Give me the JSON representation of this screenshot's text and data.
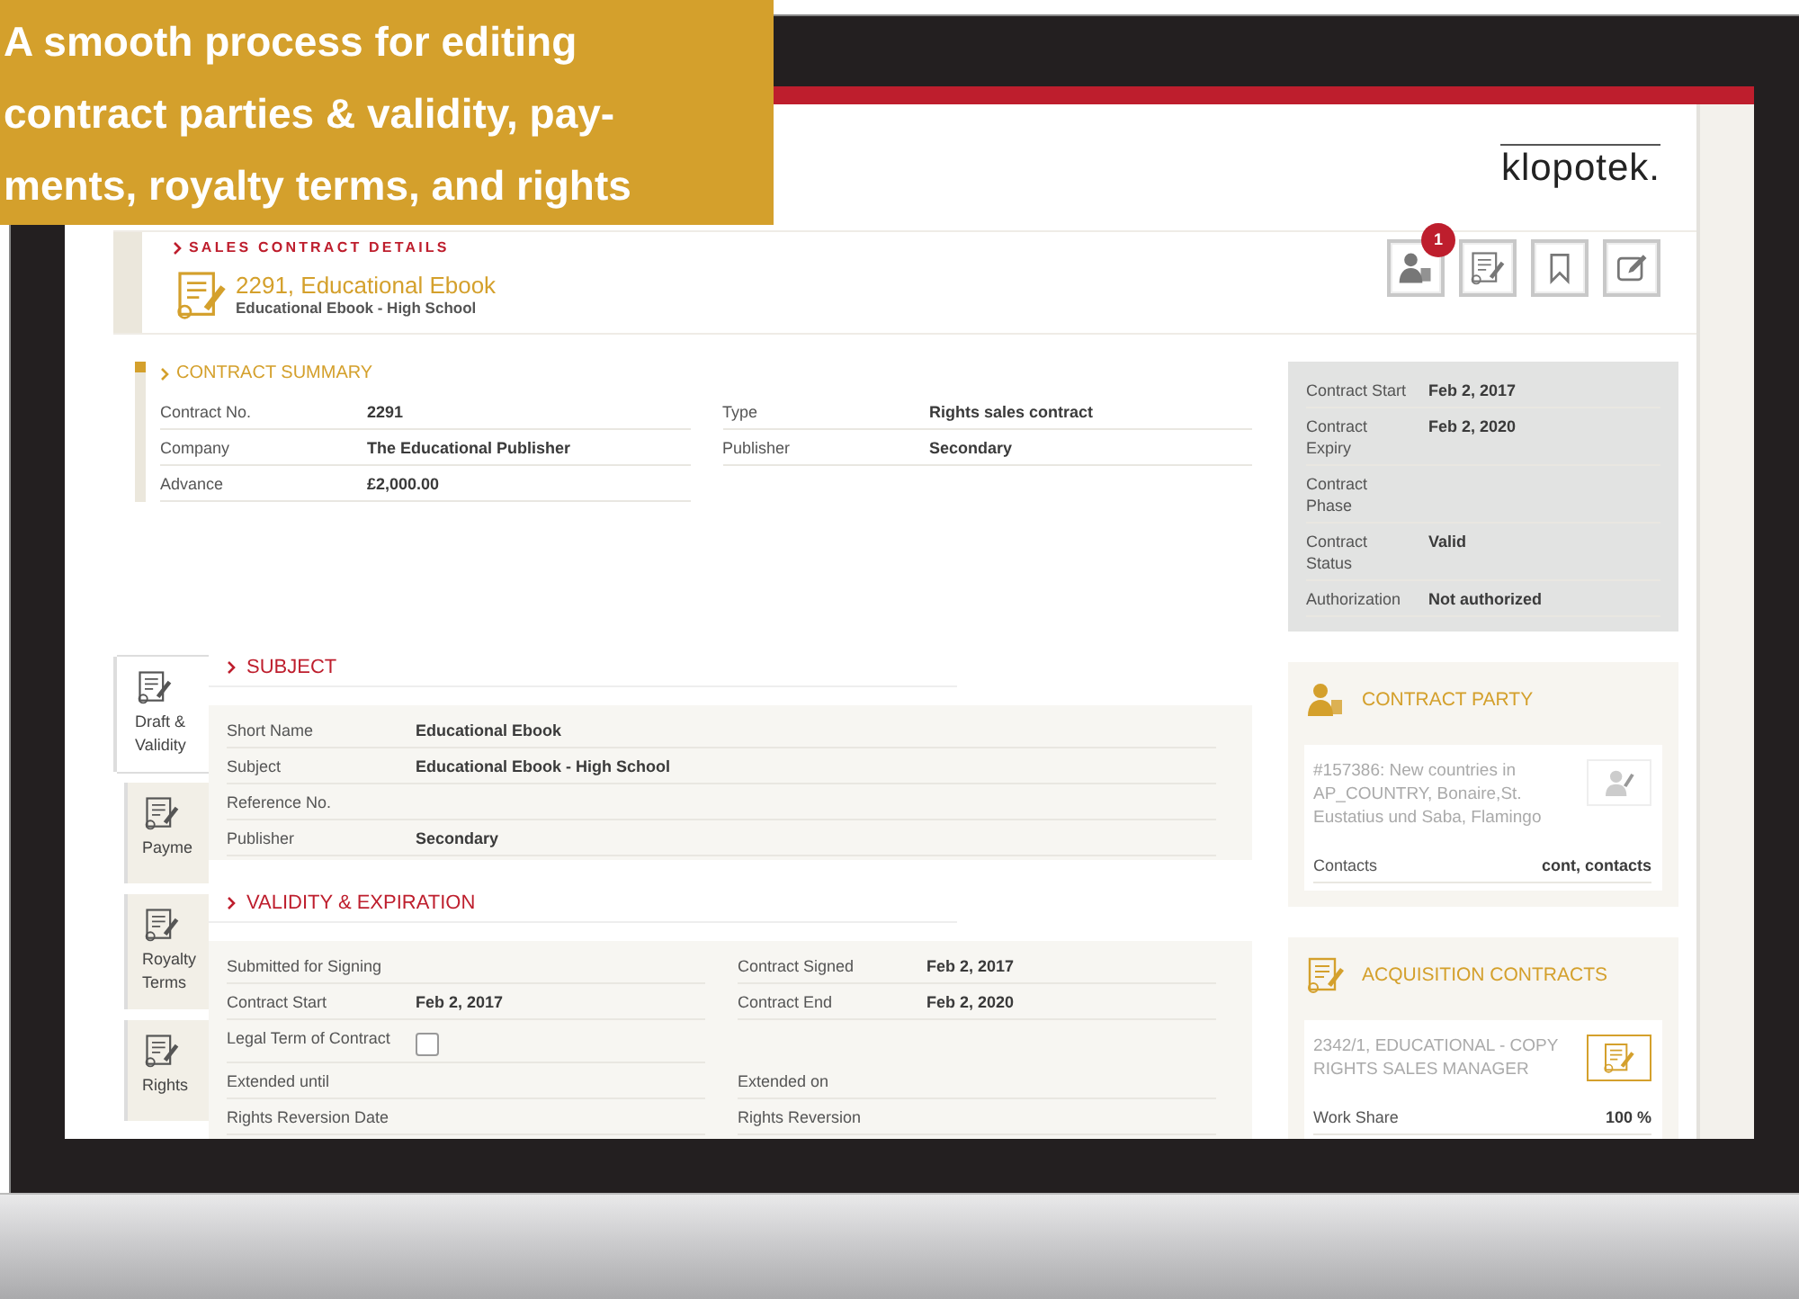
{
  "banner": {
    "lines": [
      "A smooth process for editing",
      "contract parties & validity, pay-",
      "ments, royalty terms, and rights"
    ]
  },
  "header": {
    "logo": "klopotek.",
    "breadcrumb": "SALES CONTRACT DETAILS",
    "title": "2291, Educational Ebook",
    "subtitle": "Educational Ebook - High School",
    "toolbar": [
      {
        "kind": "people",
        "badge": "1"
      },
      {
        "kind": "contract"
      },
      {
        "kind": "bookmark"
      },
      {
        "kind": "edit"
      }
    ]
  },
  "summary": {
    "heading": "CONTRACT SUMMARY",
    "columns": [
      [
        {
          "label": "Contract No.",
          "value": "2291"
        },
        {
          "label": "Company",
          "value": "The Educational Publisher"
        },
        {
          "label": "Advance",
          "value": "£2,000.00"
        }
      ],
      [
        {
          "label": "Type",
          "value": "Rights sales contract"
        },
        {
          "label": "Publisher",
          "value": "Secondary"
        }
      ]
    ]
  },
  "status": {
    "fields": [
      {
        "label": "Contract Start",
        "value": "Feb 2, 2017"
      },
      {
        "label": "Contract Expiry",
        "value": "Feb 2, 2020"
      },
      {
        "label": "Contract Phase"
      },
      {
        "label": "Contract Status",
        "value": "Valid"
      },
      {
        "label": "Authorization",
        "value": "Not authorized"
      }
    ]
  },
  "tabs": [
    {
      "label": "Draft & Validity",
      "selected": true
    },
    {
      "label": "Payme",
      "selected": false
    },
    {
      "label": "Royalty Terms",
      "selected": false
    },
    {
      "label": "Rights",
      "selected": false
    }
  ],
  "subject": {
    "heading": "SUBJECT",
    "fields": [
      {
        "label": "Short Name",
        "value": "Educational Ebook"
      },
      {
        "label": "Subject",
        "value": "Educational Ebook - High School"
      },
      {
        "label": "Reference No."
      },
      {
        "label": "Publisher",
        "value": "Secondary"
      }
    ]
  },
  "validity": {
    "heading": "VALIDITY & EXPIRATION",
    "rows": [
      [
        {
          "kind": "text",
          "label": "Submitted for Signing"
        },
        {
          "kind": "text",
          "label": "Contract Signed",
          "value": "Feb 2, 2017"
        }
      ],
      [
        {
          "kind": "text",
          "label": "Contract Start",
          "value": "Feb 2, 2017"
        },
        {
          "kind": "text",
          "label": "Contract End",
          "value": "Feb 2, 2020"
        }
      ],
      [
        {
          "kind": "checkbox",
          "label": "Legal Term of Contract",
          "checked": false
        }
      ],
      [
        {
          "kind": "text",
          "label": "Extended until"
        },
        {
          "kind": "text",
          "label": "Extended on"
        }
      ],
      [
        {
          "kind": "text",
          "label": "Rights Reversion Date"
        },
        {
          "kind": "text",
          "label": "Rights Reversion"
        }
      ]
    ]
  },
  "contract_party": {
    "heading": "CONTRACT PARTY",
    "text": "#157386: New countries in AP_COUNTRY, Bonaire,St. Eustatius und Saba, Flamingo",
    "highlighted": false,
    "fields": [
      {
        "label": "Contacts",
        "value": "cont, contacts"
      }
    ]
  },
  "acquisition": {
    "heading": "ACQUISITION CONTRACTS",
    "text": "2342/1, EDUCATIONAL - COPY RIGHTS SALES MANAGER",
    "highlighted": true,
    "fields": [
      {
        "label": "Work Share",
        "value": "100 %"
      }
    ]
  }
}
